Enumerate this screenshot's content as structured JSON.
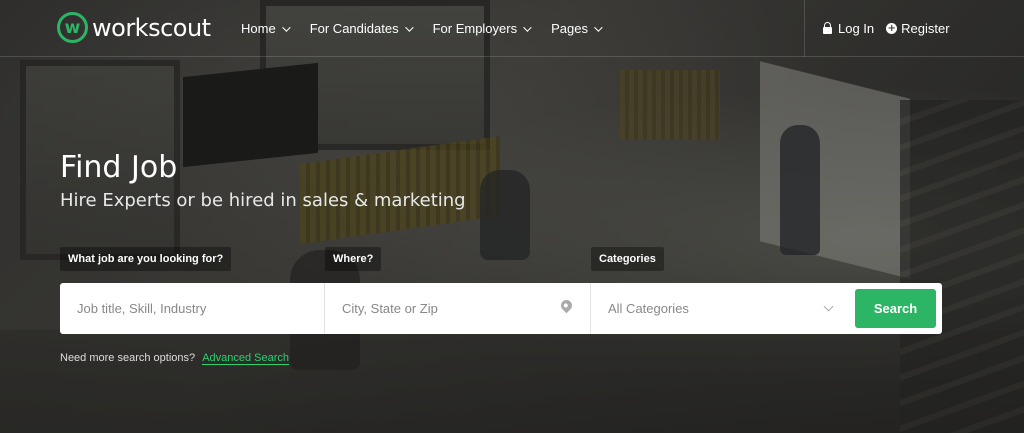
{
  "header": {
    "logo_mark": "w",
    "logo_text": "workscout",
    "nav": [
      {
        "label": "Home"
      },
      {
        "label": "For Candidates"
      },
      {
        "label": "For Employers"
      },
      {
        "label": "Pages"
      }
    ],
    "login_label": "Log In",
    "register_label": "Register"
  },
  "hero": {
    "title": "Find Job",
    "subtitle": "Hire Experts or be hired in sales & marketing"
  },
  "search": {
    "job_label": "What job are you looking for?",
    "where_label": "Where?",
    "categories_label": "Categories",
    "job_placeholder": "Job title, Skill, Industry",
    "location_placeholder": "City, State or Zip",
    "category_value": "All Categories",
    "button_label": "Search"
  },
  "more_options": {
    "text": "Need more search options?",
    "link": "Advanced Search"
  },
  "colors": {
    "accent": "#2bb564"
  },
  "icons": {
    "lock": "lock-icon",
    "register": "plus-circle-icon",
    "location": "map-pin-icon",
    "dropdown": "chevron-down-icon"
  }
}
